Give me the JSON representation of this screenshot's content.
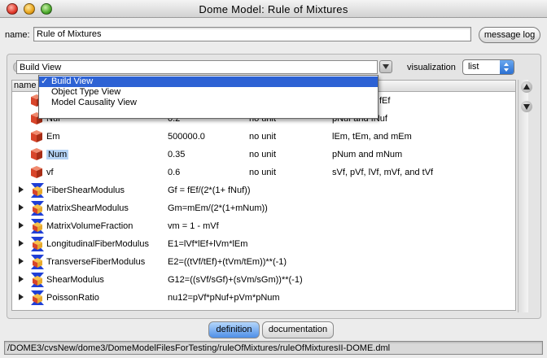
{
  "window": {
    "title": "Dome Model: Rule of Mixtures"
  },
  "name_field": {
    "label": "name:",
    "value": "Rule of Mixtures"
  },
  "message_log_button": "message log",
  "view": {
    "selected": "Build View",
    "options": [
      "Build View",
      "Object Type View",
      "Model Causality View"
    ]
  },
  "visualization": {
    "label": "visualization",
    "selected": "list"
  },
  "table": {
    "column_name": "name",
    "partial_rows": [
      {
        "name": "",
        "value": "",
        "unit": "",
        "desc": "fEf"
      },
      {
        "name": "Nuf",
        "value": "0.2",
        "unit": "no unit",
        "desc": "pNuf and fNuf"
      }
    ],
    "rows": [
      {
        "name": "Em",
        "value": "500000.0",
        "unit": "no unit",
        "desc": "lEm, tEm, and mEm"
      },
      {
        "name": "Num",
        "value": "0.35",
        "unit": "no unit",
        "desc": "pNum and mNum"
      },
      {
        "name": "vf",
        "value": "0.6",
        "unit": "no unit",
        "desc": "sVf, pVf, lVf, mVf, and tVf"
      }
    ],
    "relations": [
      {
        "name": "FiberShearModulus",
        "equation": "Gf = fEf/(2*(1+ fNuf))"
      },
      {
        "name": "MatrixShearModulus",
        "equation": "Gm=mEm/(2*(1+mNum))"
      },
      {
        "name": "MatrixVolumeFraction",
        "equation": "vm = 1 - mVf"
      },
      {
        "name": "LongitudinalFiberModulus",
        "equation": "E1=lVf*lEf+lVm*lEm"
      },
      {
        "name": "TransverseFiberModulus",
        "equation": "E2=((tVf/tEf)+(tVm/tEm))**(-1)"
      },
      {
        "name": "ShearModulus",
        "equation": "G12=((sVf/sGf)+(sVm/sGm))**(-1)"
      },
      {
        "name": "PoissonRatio",
        "equation": "nu12=pVf*pNuf+pVm*pNum"
      }
    ]
  },
  "tabs": {
    "definition": "definition",
    "documentation": "documentation"
  },
  "status": {
    "path": "/DOME3/cvsNew/dome3/DomeModelFilesForTesting/ruleOfMixtures/ruleOfMixturesII-DOME.dml"
  },
  "colors": {
    "accent": "#2d62d4",
    "cube": "#d8452a",
    "relation_blue": "#1f3fd6"
  }
}
